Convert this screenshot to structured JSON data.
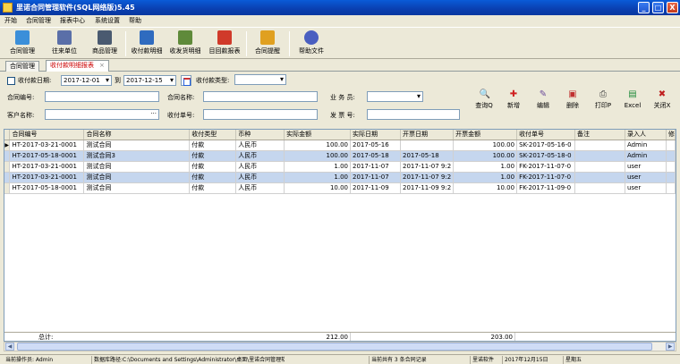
{
  "window": {
    "title": "里诺合同管理软件(SQL网络版)5.45",
    "min_label": "_",
    "max_label": "□",
    "close_label": "X"
  },
  "menu": {
    "items": [
      {
        "label": "开始"
      },
      {
        "label": "合同管理"
      },
      {
        "label": "报表中心"
      },
      {
        "label": "系统设置"
      },
      {
        "label": "帮助"
      }
    ]
  },
  "toolbar": {
    "buttons": [
      {
        "label": "合同管理",
        "icon": "contract-icon",
        "color": "#3b8fd9"
      },
      {
        "label": "往来单位",
        "icon": "partner-icon",
        "color": "#5a6fa8"
      },
      {
        "label": "商品管理",
        "icon": "product-icon",
        "color": "#4a5a70"
      },
      {
        "label": "收付款明细",
        "icon": "payment-detail-icon",
        "color": "#2f6bbf"
      },
      {
        "label": "收发货明细",
        "icon": "shipping-detail-icon",
        "color": "#5f8a3a"
      },
      {
        "label": "目回款报表",
        "icon": "bar-chart-icon",
        "color": "#d03a2a"
      },
      {
        "label": "合同提醒",
        "icon": "reminder-icon",
        "color": "#e0a020"
      },
      {
        "label": "帮助文件",
        "icon": "help-icon",
        "color": "#4a5fc0"
      }
    ]
  },
  "tabs": [
    {
      "label": "合同管理",
      "active": false
    },
    {
      "label": "收付款明细报表",
      "active": true,
      "close": "×"
    }
  ],
  "filter": {
    "payment_date_label": "收付款日期:",
    "date_from": "2017-12-01",
    "to_label": "到",
    "date_to": "2017-12-15",
    "payment_type_label": "收付款类型:",
    "payment_type_value": "",
    "contract_no_label": "合同编号:",
    "contract_no_value": "",
    "contract_name_label": "合同名称:",
    "contract_name_value": "",
    "salesman_label": "业 务 员:",
    "salesman_value": "",
    "customer_label": "客户名称:",
    "customer_value": "",
    "payment_no_label": "收付单号:",
    "payment_no_value": "",
    "invoice_no_label": "发 票 号:",
    "invoice_no_value": ""
  },
  "actions": [
    {
      "label": "查询Q",
      "icon": "search-icon",
      "glyph": "🔍",
      "color": "#3a5fa8"
    },
    {
      "label": "新增",
      "icon": "add-icon",
      "glyph": "✚",
      "color": "#d02020"
    },
    {
      "label": "编辑",
      "icon": "edit-icon",
      "glyph": "✎",
      "color": "#6a4a9a"
    },
    {
      "label": "删除",
      "icon": "delete-icon",
      "glyph": "▣",
      "color": "#c03030"
    },
    {
      "label": "打印P",
      "icon": "print-icon",
      "glyph": "⎙",
      "color": "#404040"
    },
    {
      "label": "Excel",
      "icon": "excel-icon",
      "glyph": "▤",
      "color": "#1f8a3a"
    },
    {
      "label": "关闭X",
      "icon": "close-icon",
      "glyph": "✖",
      "color": "#c02020"
    }
  ],
  "grid": {
    "columns": [
      "合同编号",
      "合同名称",
      "收付类型",
      "币种",
      "实际金额",
      "实际日期",
      "开票日期",
      "开票金额",
      "收付单号",
      "备注",
      "录入人",
      "修"
    ],
    "rows": [
      {
        "contract_no": "HT-2017-03-21-0001",
        "name": "测试合同",
        "type": "付款",
        "currency": "人民币",
        "amount": "100.00",
        "date": "2017-05-16",
        "invoice_date": "",
        "invoice_amount": "100.00",
        "pay_no": "SK-2017-05-16-0",
        "note": "",
        "user": "Admin",
        "selected": false,
        "current": true
      },
      {
        "contract_no": "HT-2017-05-18-0001",
        "name": "测试合同3",
        "type": "付款",
        "currency": "人民币",
        "amount": "100.00",
        "date": "2017-05-18",
        "invoice_date": "2017-05-18",
        "invoice_amount": "100.00",
        "pay_no": "SK-2017-05-18-0",
        "note": "",
        "user": "Admin",
        "selected": true,
        "current": false
      },
      {
        "contract_no": "HT-2017-03-21-0001",
        "name": "测试合同",
        "type": "付款",
        "currency": "人民币",
        "amount": "1.00",
        "date": "2017-11-07",
        "invoice_date": "2017-11-07 9:2",
        "invoice_amount": "1.00",
        "pay_no": "FK-2017-11-07-0",
        "note": "",
        "user": "user",
        "selected": false,
        "current": false
      },
      {
        "contract_no": "HT-2017-03-21-0001",
        "name": "测试合同",
        "type": "付款",
        "currency": "人民币",
        "amount": "1.00",
        "date": "2017-11-07",
        "invoice_date": "2017-11-07 9:2",
        "invoice_amount": "1.00",
        "pay_no": "FK-2017-11-07-0",
        "note": "",
        "user": "user",
        "selected": true,
        "current": false
      },
      {
        "contract_no": "HT-2017-05-18-0001",
        "name": "测试合同",
        "type": "付款",
        "currency": "人民币",
        "amount": "10.00",
        "date": "2017-11-09",
        "invoice_date": "2017-11-09 9:2",
        "invoice_amount": "10.00",
        "pay_no": "FK-2017-11-09-0",
        "note": "",
        "user": "user",
        "selected": false,
        "current": false
      }
    ],
    "footer": {
      "label": "总计:",
      "amount_total": "212.00",
      "invoice_total": "203.00"
    }
  },
  "status": {
    "operator_label": "当前操作员: Admin",
    "db_path": "数据库路径:C:\\Documents and Settings\\Administrator\\桌面\\里诺合同管理软件5.45\\I",
    "record_count": "当前共有 3 条合同记录",
    "company": "里诺软件",
    "date": "2017年12月15日",
    "weekday": "星期五"
  }
}
